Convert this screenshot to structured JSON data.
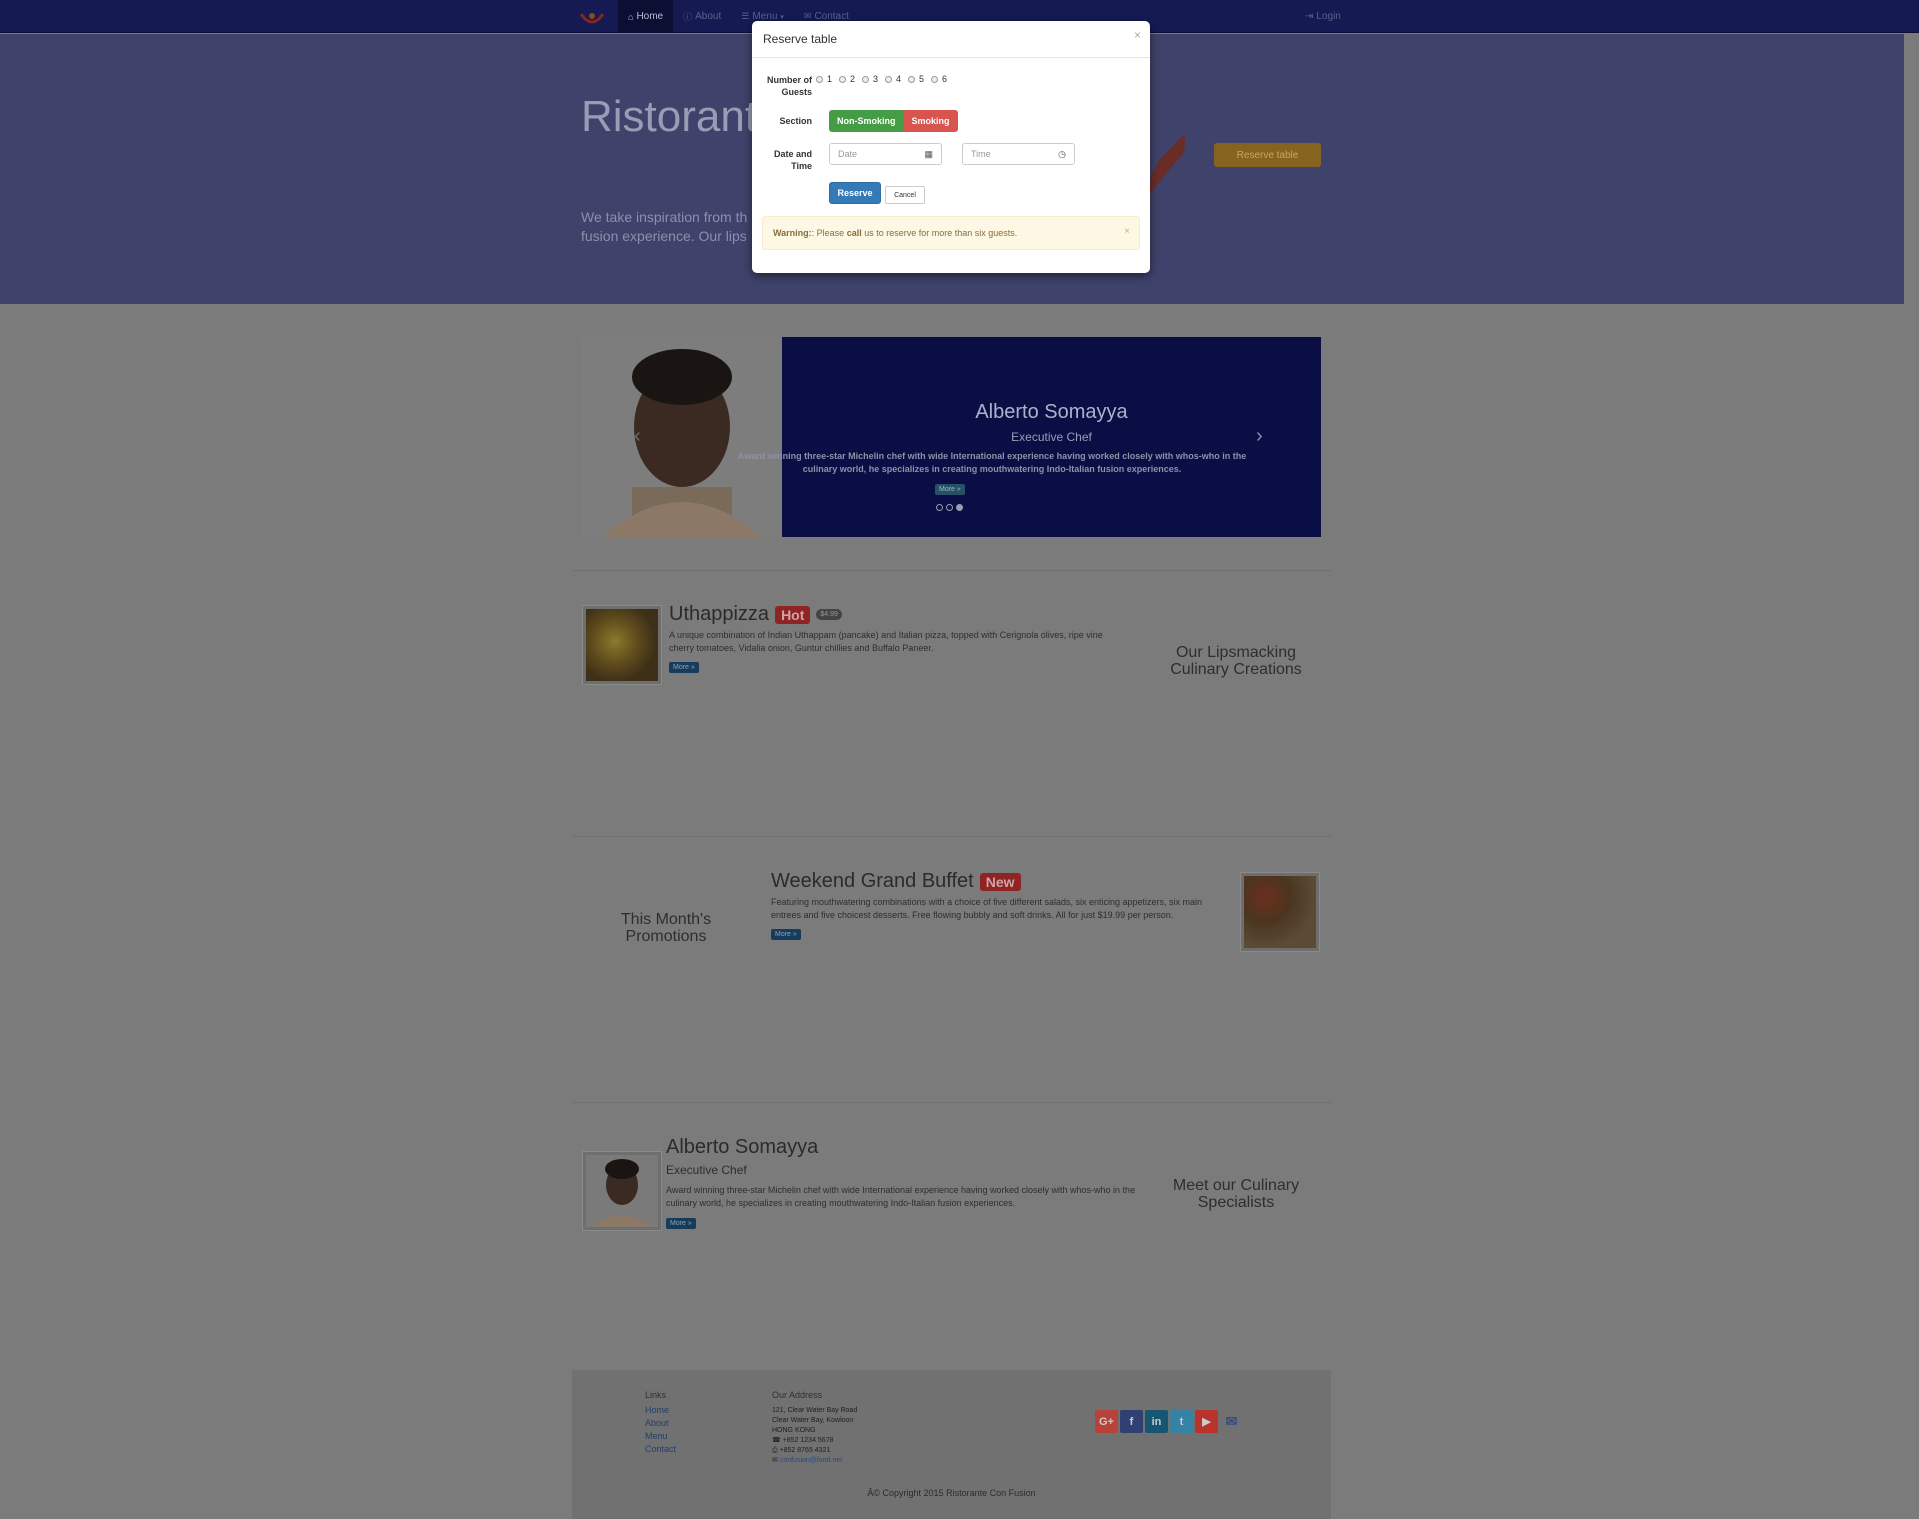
{
  "nav": {
    "items": [
      {
        "icon": "home-icon",
        "glyph": "⌂",
        "label": "Home",
        "active": true
      },
      {
        "icon": "info-icon",
        "glyph": "ⓘ",
        "label": "About"
      },
      {
        "icon": "list-icon",
        "glyph": "☰",
        "label": "Menu",
        "caret": true
      },
      {
        "icon": "envelope-icon",
        "glyph": "✉",
        "label": "Contact"
      }
    ],
    "login": "Login"
  },
  "jumbotron": {
    "title": "Ristorant",
    "text": "We take inspiration from th fusion experience. Our lips",
    "reserve_button": "Reserve table"
  },
  "carousel": {
    "name": "Alberto Somayya",
    "role": "Executive Chef",
    "description": "Award winning three-star Michelin chef with wide International experience having worked closely with whos-who in the culinary world, he specializes in creating mouthwatering Indo-Italian fusion experiences.",
    "more": "More »",
    "active_slide": 3,
    "slide_count": 3
  },
  "dish": {
    "name": "Uthappizza",
    "badge": "Hot",
    "price": "$4.99",
    "description": "A unique combination of Indian Uthappam (pancake) and Italian pizza, topped with Cerignola olives, ripe vine cherry tomatoes, Vidalia onion, Guntur chillies and Buffalo Paneer.",
    "more": "More »",
    "side_title": "Our Lipsmacking Culinary Creations"
  },
  "promotion": {
    "name": "Weekend Grand Buffet",
    "badge": "New",
    "description": "Featuring mouthwatering combinations with a choice of five different salads, six enticing appetizers, six main entrees and five choicest desserts. Free flowing bubbly and soft drinks. All for just $19.99 per person.",
    "more": "More »",
    "side_title": "This Month's Promotions"
  },
  "leader": {
    "name": "Alberto Somayya",
    "role": "Executive Chef",
    "description": "Award winning three-star Michelin chef with wide International experience having worked closely with whos-who in the culinary world, he specializes in creating mouthwatering Indo-Italian fusion experiences.",
    "more": "More »",
    "side_title": "Meet our Culinary Specialists"
  },
  "footer": {
    "links_heading": "Links",
    "links": [
      "Home",
      "About",
      "Menu",
      "Contact"
    ],
    "address_heading": "Our Address",
    "address_lines": [
      "121, Clear Water Bay Road",
      "Clear Water Bay, Kowloon",
      "HONG KONG"
    ],
    "phone": "+852 1234 5678",
    "fax": "+852 8765 4321",
    "email": "confusion@food.net",
    "social": [
      {
        "icon": "google-plus-icon",
        "glyph": "G+",
        "color": "#b8413a"
      },
      {
        "icon": "facebook-icon",
        "glyph": "f",
        "color": "#2f4173"
      },
      {
        "icon": "linkedin-icon",
        "glyph": "in",
        "color": "#175673"
      },
      {
        "icon": "twitter-icon",
        "glyph": "t",
        "color": "#3682a4"
      },
      {
        "icon": "youtube-icon",
        "glyph": "▶",
        "color": "#b8332b"
      },
      {
        "icon": "mail-icon",
        "glyph": "✉",
        "color": "transparent"
      }
    ],
    "copyright": "Â© Copyright 2015 Ristorante Con Fusion"
  },
  "modal": {
    "title": "Reserve table",
    "close": "×",
    "guests_label": "Number of Guests",
    "guest_options": [
      "1",
      "2",
      "3",
      "4",
      "5",
      "6"
    ],
    "section_label": "Section",
    "section_options": [
      "Non-Smoking",
      "Smoking"
    ],
    "datetime_label": "Date and Time",
    "date_placeholder": "Date",
    "time_placeholder": "Time",
    "reserve": "Reserve",
    "cancel": "Cancel",
    "warning_strong": "Warning:",
    "warning_pre": ": Please ",
    "warning_call": "call",
    "warning_post": " us to reserve for more than six guests.",
    "warning_close": "×"
  },
  "colors": {
    "navbar": "#151a53",
    "jumbotron": "#3f426b",
    "carousel": "#0b0e45",
    "primary": "#337ab7",
    "success": "#449d44",
    "danger": "#d9534f",
    "warning_bg": "#fcf8e3"
  }
}
